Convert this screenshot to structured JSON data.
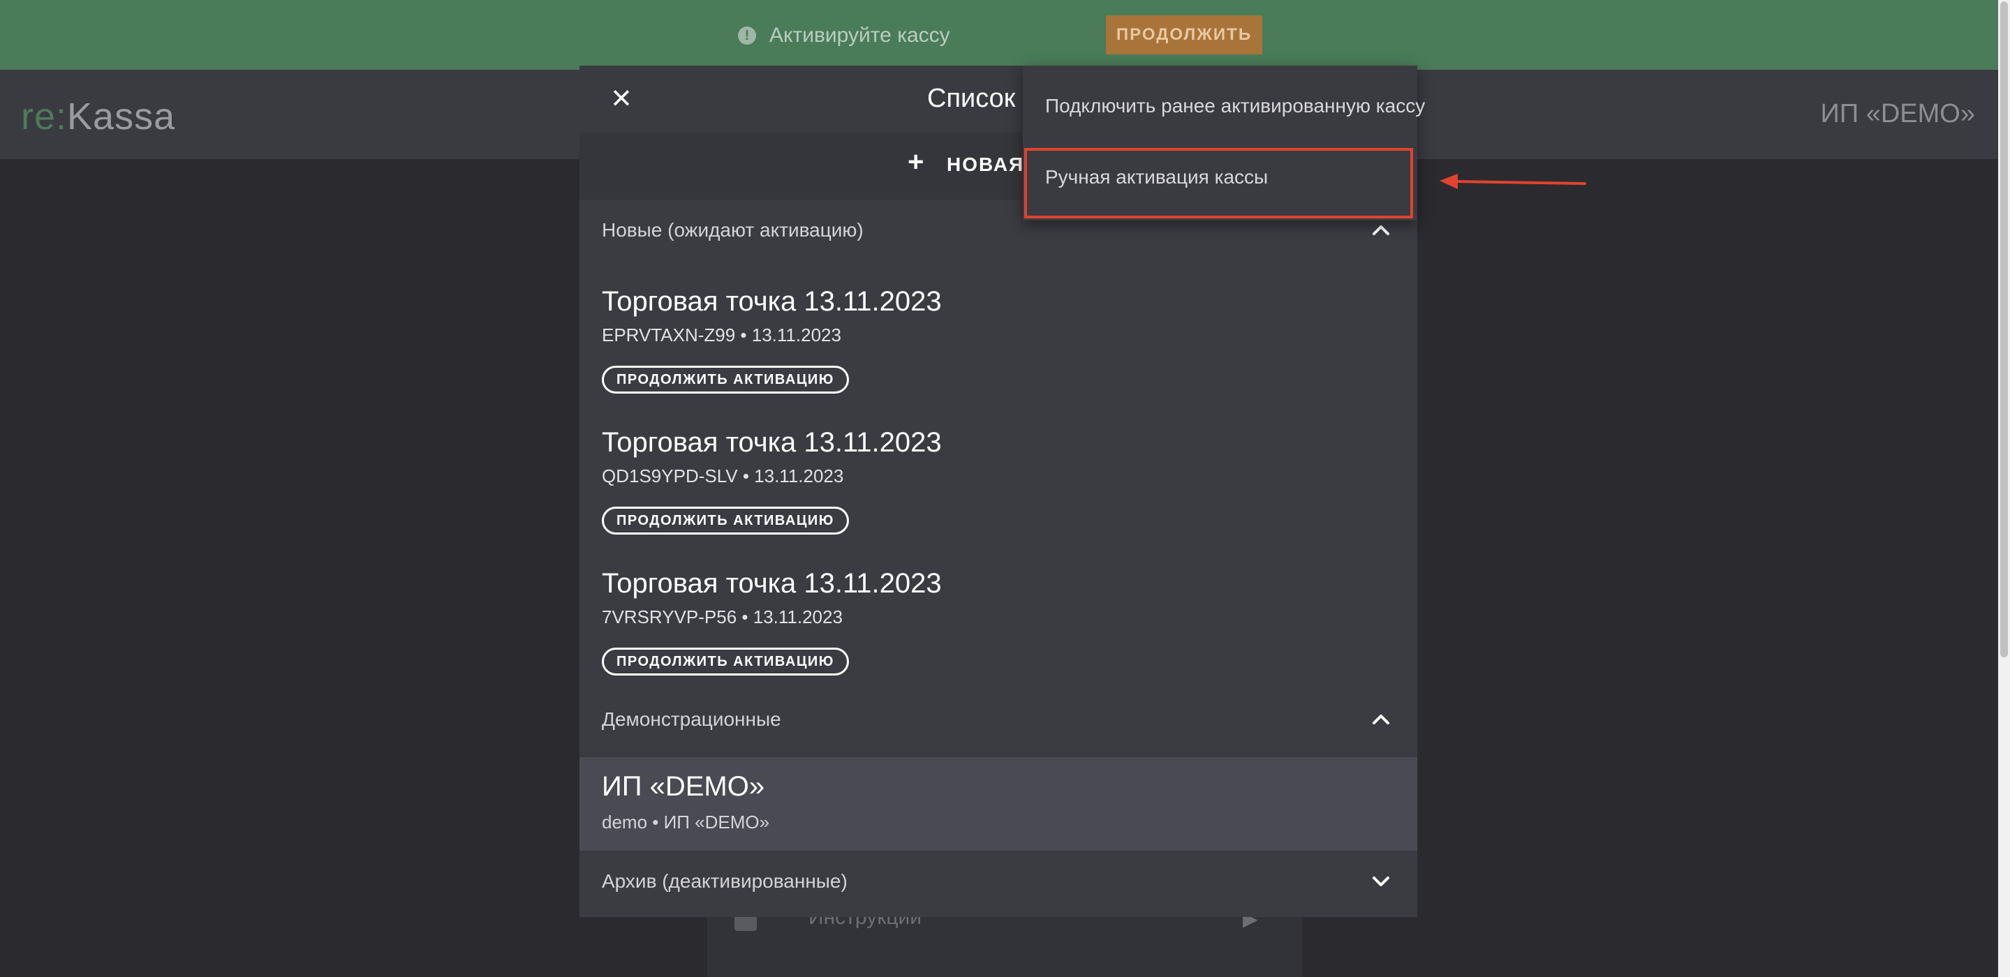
{
  "banner": {
    "icon": "info-icon",
    "text": "Активируйте кассу",
    "button_label": "ПРОДОЛЖИТЬ",
    "color": "#4a7c5a",
    "button_color": "#a8743a"
  },
  "header": {
    "logo_re": "re:",
    "logo_kassa": "Kassa",
    "org_name": "ИП «DEMO»"
  },
  "background_page": {
    "instructions_label": "Инструкции"
  },
  "modal": {
    "close_icon": "close-icon",
    "title": "Список к",
    "new_button_label": "НОВАЯ К",
    "sections": {
      "new": {
        "title": "Новые (ожидают активацию)",
        "expanded": true,
        "stores": [
          {
            "name": "Торговая точка 13.11.2023",
            "subtitle": "EPRVTAXN-Z99 • 13.11.2023",
            "button_label": "ПРОДОЛЖИТЬ АКТИВАЦИЮ"
          },
          {
            "name": "Торговая точка 13.11.2023",
            "subtitle": "QD1S9YPD-SLV • 13.11.2023",
            "button_label": "ПРОДОЛЖИТЬ АКТИВАЦИЮ"
          },
          {
            "name": "Торговая точка 13.11.2023",
            "subtitle": "7VRSRYVP-P56 • 13.11.2023",
            "button_label": "ПРОДОЛЖИТЬ АКТИВАЦИЮ"
          }
        ]
      },
      "demo": {
        "title": "Демонстрационные",
        "expanded": true,
        "item": {
          "name": "ИП «DEMO»",
          "subtitle": "demo • ИП «DEMO»"
        }
      },
      "archive": {
        "title": "Архив (деактивированные)",
        "expanded": false
      }
    }
  },
  "menu": {
    "items": [
      {
        "label": "Подключить ранее активированную кассу"
      },
      {
        "label": "Ручная активация кассы",
        "highlighted": true
      }
    ],
    "highlight_color": "#e0432f"
  }
}
